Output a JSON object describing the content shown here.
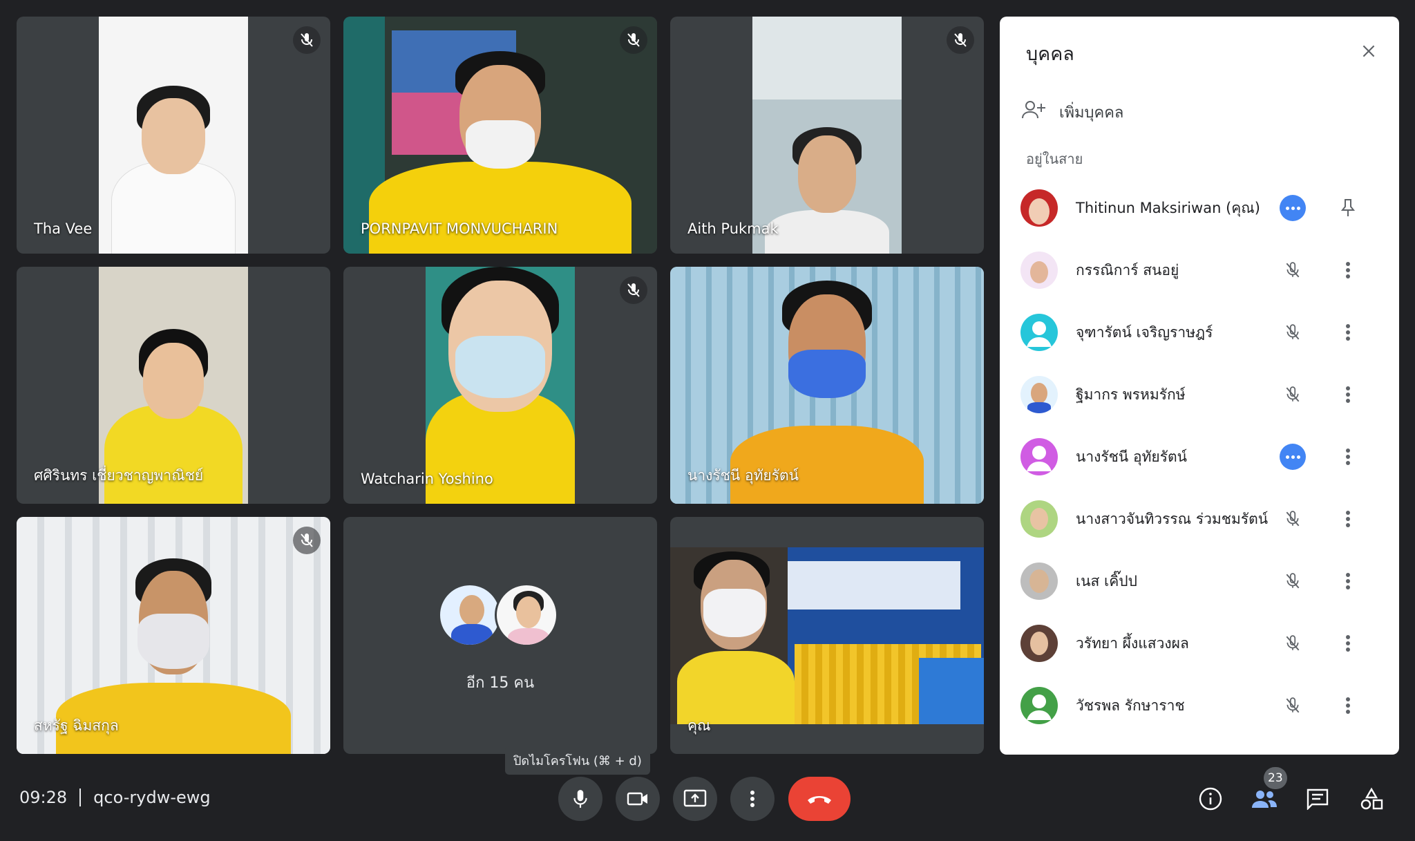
{
  "tiles": [
    {
      "name": "Tha Vee",
      "muted": true
    },
    {
      "name": "PORNPAVIT MONVUCHARIN",
      "muted": true
    },
    {
      "name": "Aith Pukmak",
      "muted": true
    },
    {
      "name": "ศศิรินทร เชี่ยวชาญพาณิชย์",
      "muted": false
    },
    {
      "name": "Watcharin Yoshino",
      "muted": true
    },
    {
      "name": "นางรัชนี อุทัยรัตน์",
      "muted": false
    },
    {
      "name": "สหรัฐ ฉิมสกุล",
      "muted": true
    },
    {
      "name": "คุณ",
      "muted": false
    }
  ],
  "more_tile": {
    "label": "อีก 15 คน"
  },
  "tooltip": "ปิดไมโครโฟน (⌘ + d)",
  "panel": {
    "title": "บุคคล",
    "add_label": "เพิ่มบุคคล",
    "section_label": "อยู่ในสาย",
    "participants": [
      {
        "name": "Thitinun Maksiriwan (คุณ)",
        "status": "speaking",
        "action": "pin",
        "avatar_color": "#c62828"
      },
      {
        "name": "กรรณิการ์ สนอยู่",
        "status": "muted",
        "action": "more",
        "avatar_color": "#f3e5f5"
      },
      {
        "name": "จุฑารัตน์ เจริญราษฎร์",
        "status": "muted",
        "action": "more",
        "avatar_color": "#26c6da"
      },
      {
        "name": "ฐิมากร พรหมรักษ์",
        "status": "muted",
        "action": "more",
        "avatar_color": "#e3f2fd"
      },
      {
        "name": "นางรัชนี อุทัยรัตน์",
        "status": "speaking",
        "action": "more",
        "avatar_color": "#d05ce3"
      },
      {
        "name": "นางสาวจันทิวรรณ ร่วมชมรัตน์",
        "status": "muted",
        "action": "more",
        "avatar_color": "#aed581"
      },
      {
        "name": "เนส เคิ๊ปป",
        "status": "muted",
        "action": "more",
        "avatar_color": "#bdbdbd"
      },
      {
        "name": "วรัทยา ผึ้งแสวงผล",
        "status": "muted",
        "action": "more",
        "avatar_color": "#5d4037"
      },
      {
        "name": "วัชรพล รักษาราช",
        "status": "muted",
        "action": "more",
        "avatar_color": "#43a047"
      }
    ]
  },
  "bottom": {
    "time": "09:28",
    "meeting_code": "qco-rydw-ewg",
    "people_count": "23"
  },
  "colors": {
    "end_call": "#ea4335",
    "active_blue": "#4285f4",
    "bar_bg": "#202124",
    "tile_bg": "#3c4043"
  }
}
